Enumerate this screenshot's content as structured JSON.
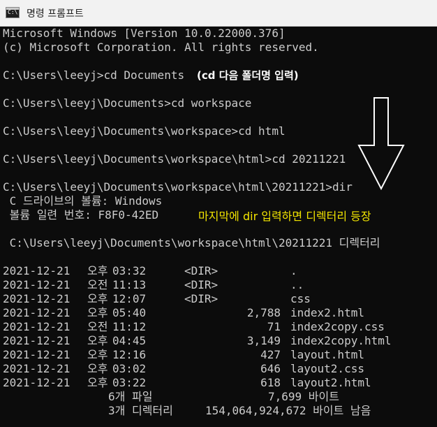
{
  "window": {
    "title": "명령 프롬프트",
    "icon": "cmd-icon"
  },
  "terminal": {
    "header": [
      "Microsoft Windows [Version 10.0.22000.376]",
      "(c) Microsoft Corporation. All rights reserved."
    ],
    "commands": [
      "C:\\Users\\leeyj>cd Documents",
      "C:\\Users\\leeyj\\Documents>cd workspace",
      "C:\\Users\\leeyj\\Documents\\workspace>cd html",
      "C:\\Users\\leeyj\\Documents\\workspace\\html>cd 20211221",
      "C:\\Users\\leeyj\\Documents\\workspace\\html\\20211221>dir"
    ],
    "volume_line": " C 드라이브의 볼륨: Windows",
    "serial_line": " 볼륨 일련 번호: F8F0-42ED",
    "dir_line": " C:\\Users\\leeyj\\Documents\\workspace\\html\\20211221 디렉터리",
    "entries": [
      {
        "date": "2021-12-21",
        "ampm": "오후",
        "time": "03:32",
        "type": "<DIR>",
        "size": "",
        "name": "."
      },
      {
        "date": "2021-12-21",
        "ampm": "오전",
        "time": "11:13",
        "type": "<DIR>",
        "size": "",
        "name": ".."
      },
      {
        "date": "2021-12-21",
        "ampm": "오후",
        "time": "12:07",
        "type": "<DIR>",
        "size": "",
        "name": "css"
      },
      {
        "date": "2021-12-21",
        "ampm": "오후",
        "time": "05:40",
        "type": "",
        "size": "2,788",
        "name": "index2.html"
      },
      {
        "date": "2021-12-21",
        "ampm": "오전",
        "time": "11:12",
        "type": "",
        "size": "71",
        "name": "index2copy.css",
        "highlight": true
      },
      {
        "date": "2021-12-21",
        "ampm": "오후",
        "time": "04:45",
        "type": "",
        "size": "3,149",
        "name": "index2copy.html"
      },
      {
        "date": "2021-12-21",
        "ampm": "오후",
        "time": "12:16",
        "type": "",
        "size": "427",
        "name": "layout.html"
      },
      {
        "date": "2021-12-21",
        "ampm": "오후",
        "time": "03:02",
        "type": "",
        "size": "646",
        "name": "layout2.css",
        "highlight": true
      },
      {
        "date": "2021-12-21",
        "ampm": "오후",
        "time": "03:22",
        "type": "",
        "size": "618",
        "name": "layout2.html"
      }
    ],
    "summary_files": "6개 파일",
    "summary_files_bytes": "7,699 바이트",
    "summary_dirs": "3개 디렉터리",
    "summary_dirs_bytes": "154,064,924,672 바이트 남음"
  },
  "annotations": {
    "cd_note": "(cd 다음 폴더명 입력)",
    "dir_note": "마지막에 dir 입력하면 디렉터리 등장",
    "arrow": "down-arrow-icon"
  },
  "colors": {
    "terminal_bg": "#0c0c0c",
    "terminal_text": "#cccccc",
    "highlight": "#d6d33a",
    "note_yellow": "#f1e300"
  }
}
